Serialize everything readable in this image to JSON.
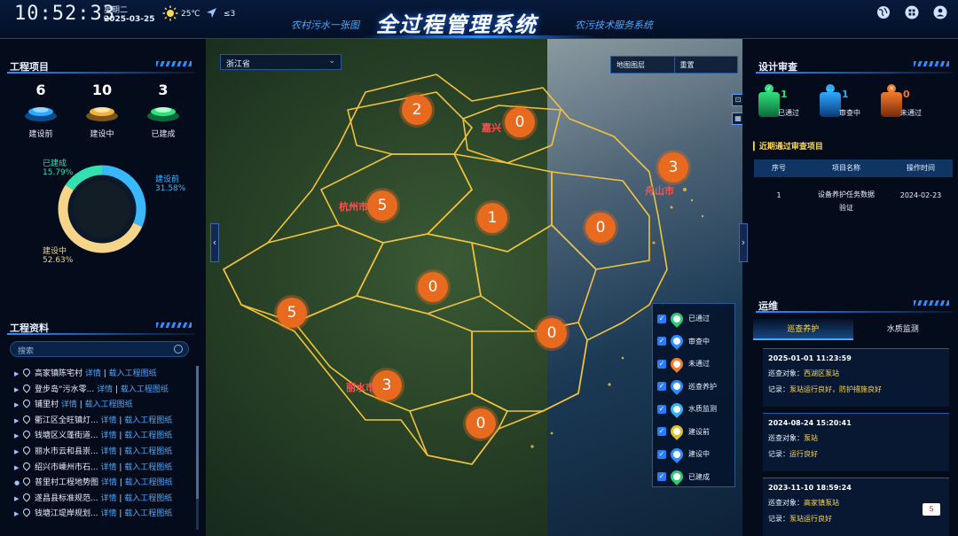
{
  "header": {
    "time": "10:52:33",
    "weekday": "星期二",
    "date": "2025-03-25",
    "temperature": "25℃",
    "wind": "≤3",
    "subtitle_left": "农村污水一张图",
    "title": "全过程管理系统",
    "subtitle_right": "农污技术服务系统",
    "icons": [
      "globe-icon",
      "grid-icon",
      "user-icon"
    ]
  },
  "projects": {
    "title": "工程项目",
    "stats": [
      {
        "value": "6",
        "label": "建设前",
        "color": "#2fa8ff"
      },
      {
        "value": "10",
        "label": "建设中",
        "color": "#f2b33a"
      },
      {
        "value": "3",
        "label": "已建成",
        "color": "#2fe07a"
      }
    ],
    "donut": [
      {
        "label": "建设前",
        "percent": "31.58%",
        "value": 31.58,
        "color": "#39b7ff"
      },
      {
        "label": "建设中",
        "percent": "52.63%",
        "value": 52.63,
        "color": "#f4d58a"
      },
      {
        "label": "已建成",
        "percent": "15.79%",
        "value": 15.79,
        "color": "#33e0b0"
      }
    ]
  },
  "docs": {
    "title": "工程资料",
    "search_placeholder": "搜索",
    "detail_label": "详情",
    "load_label": "载入工程图纸",
    "items": [
      {
        "name": "高家镇陈宅村",
        "expandable": true
      },
      {
        "name": "登步岛“污水零...",
        "expandable": true
      },
      {
        "name": "铺里村",
        "expandable": true
      },
      {
        "name": "衢江区全旺镇灯...",
        "expandable": true
      },
      {
        "name": "钱塘区义蓬街道...",
        "expandable": true
      },
      {
        "name": "丽水市云和县崇...",
        "expandable": true
      },
      {
        "name": "绍兴市嵊州市石...",
        "expandable": true
      },
      {
        "name": "普里村工程地势图",
        "expandable": false
      },
      {
        "name": "遂昌县标准规范...",
        "expandable": true
      },
      {
        "name": "钱塘江堤岸规划...",
        "expandable": true
      }
    ]
  },
  "map": {
    "province": "浙江省",
    "layer_left": "地图图层",
    "layer_right": "重置",
    "clusters": [
      "2",
      "0",
      "3",
      "5",
      "1",
      "0",
      "0",
      "5",
      "0",
      "3",
      "0"
    ],
    "cities": [
      "嘉兴",
      "杭州市",
      "舟山市",
      "丽水市"
    ],
    "legend": [
      {
        "label": "已通过",
        "color": "#2ecc71"
      },
      {
        "label": "审查中",
        "color": "#2f8dff"
      },
      {
        "label": "未通过",
        "color": "#f07b2a"
      },
      {
        "label": "巡查养护",
        "color": "#2f8dff"
      },
      {
        "label": "水质监测",
        "color": "#2fb3ff"
      },
      {
        "label": "建设前",
        "color": "#e0c02a"
      },
      {
        "label": "建设中",
        "color": "#2f8dff"
      },
      {
        "label": "已建成",
        "color": "#2ecc71"
      }
    ]
  },
  "review": {
    "title": "设计审查",
    "stats": [
      {
        "value": "1",
        "label": "已通过",
        "color": "#2fe07a"
      },
      {
        "value": "1",
        "label": "审查中",
        "color": "#2fa8ff"
      },
      {
        "value": "0",
        "label": "未通过",
        "color": "#f07b2a"
      }
    ],
    "recent_title": "近期通过审查项目",
    "columns": [
      "序号",
      "项目名称",
      "操作时间"
    ],
    "rows": [
      {
        "no": "1",
        "name_line1": "设备养护任务数据",
        "name_line2": "验证",
        "time": "2024-02-23"
      }
    ]
  },
  "om": {
    "title": "运维",
    "tabs": [
      "巡查养护",
      "水质监测"
    ],
    "object_label": "巡查对象：",
    "record_label": "记录：",
    "records": [
      {
        "time": "2025-01-01 11:23:59",
        "object": "西湖区泵站",
        "record": "泵站运行良好，防护措施良好"
      },
      {
        "time": "2024-08-24 15:20:41",
        "object": "泵站",
        "record": "运行良好"
      },
      {
        "time": "2023-11-10 18:59:24",
        "object": "高家镇泵站",
        "record": "泵站运行良好"
      }
    ]
  }
}
